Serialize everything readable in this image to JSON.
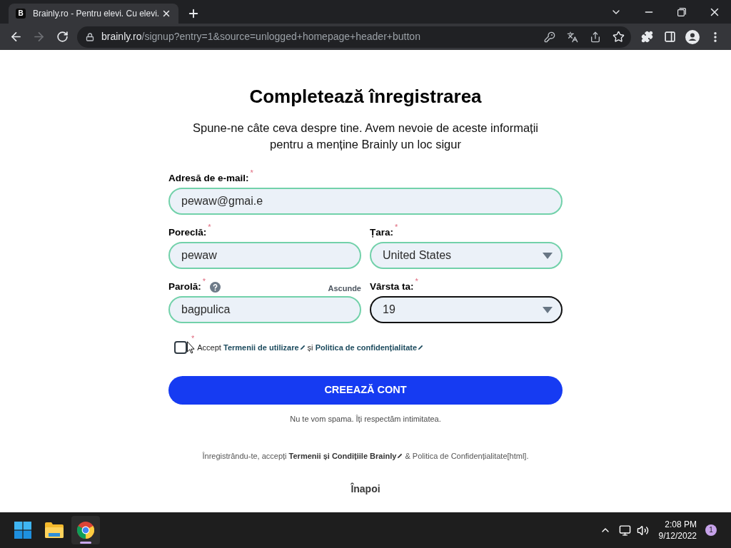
{
  "browser": {
    "tab": {
      "favicon": "B",
      "title": "Brainly.ro - Pentru elevi. Cu elevi."
    },
    "nav": {
      "forward_disabled": true
    },
    "url": {
      "host": "brainly.ro",
      "path": "/signup?entry=1&source=unlogged+homepage+header+button"
    }
  },
  "form": {
    "title": "Completează înregistrarea",
    "subtitle": "Spune-ne câte ceva despre tine. Avem nevoie de aceste informații pentru a menține Brainly un loc sigur",
    "email": {
      "label": "Adresă de e-mail:",
      "asterisk": "*",
      "value": "pewaw@gmai.e",
      "focused": false
    },
    "nickname": {
      "label": "Poreclă:",
      "asterisk": "*",
      "value": "pewaw",
      "focused": false
    },
    "country": {
      "label": "Țara:",
      "asterisk": "*",
      "value": "United States",
      "focused": false
    },
    "password": {
      "label": "Parolă:",
      "asterisk": "*",
      "action": "Ascunde",
      "value": "bagpulica",
      "focused": false
    },
    "age": {
      "label": "Vârsta ta:",
      "asterisk": "*",
      "value": "19",
      "focused": true
    },
    "consent": {
      "checked": false,
      "asterisk": "*",
      "parts": [
        {
          "kind": "text",
          "text": "Accept"
        },
        {
          "kind": "link",
          "text": "Termenii de utilizare"
        },
        {
          "kind": "text",
          "text": "și"
        },
        {
          "kind": "link",
          "text": "Politica de confidențialitate"
        }
      ]
    },
    "submit": "CREEAZĂ CONT",
    "note": "Nu te vom spama. Îți respectăm intimitatea.",
    "legal": [
      {
        "kind": "text",
        "text": "Înregistrându-te, accepți"
      },
      {
        "kind": "link",
        "text": "Termenii și Condițiile Brainly"
      },
      {
        "kind": "text",
        "text": "& Politica de Confidențialitate[html]."
      }
    ],
    "back": "Înapoi"
  },
  "taskbar": {
    "apps": [
      {
        "kind": "start",
        "selected": false
      },
      {
        "kind": "explorer",
        "selected": false
      },
      {
        "kind": "chrome",
        "selected": true
      }
    ],
    "time": "2:08 PM",
    "date": "9/12/2022",
    "notifications": "1"
  }
}
